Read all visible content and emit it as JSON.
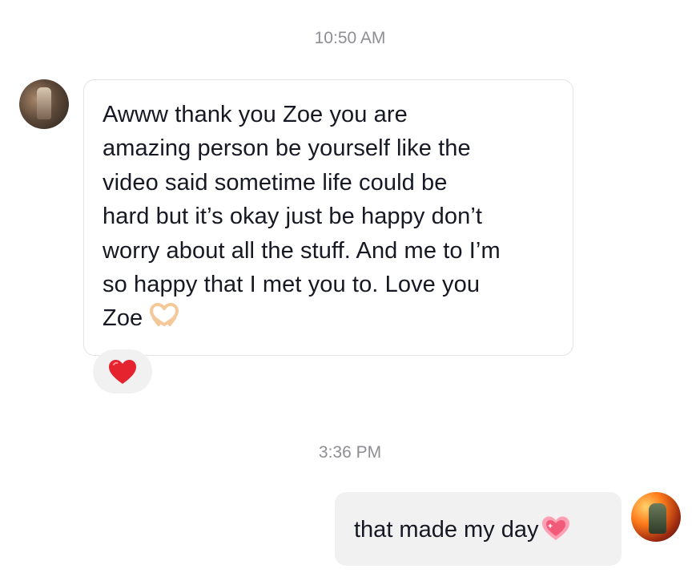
{
  "conversation": {
    "timestamps": [
      "10:50 AM",
      "3:36 PM"
    ],
    "incoming": {
      "lines": [
        "Awww thank you Zoe you are",
        "amazing person be yourself like the",
        "video said sometime life could be",
        "hard but it’s okay just be happy don’t",
        "worry about all the stuff. And me to I’m",
        "so happy that I met you to. Love you",
        "Zoe"
      ],
      "emoji": "heart-hands-icon",
      "reaction": "red-heart-icon"
    },
    "outgoing": {
      "text": "that made my day",
      "emoji": "sparkling-heart-icon"
    }
  },
  "colors": {
    "timestamp": "#8e8e93",
    "text": "#161823",
    "bubble_border": "#e3e3e6",
    "bubble_fill": "#f1f1f2",
    "reaction_heart": "#e4232f",
    "sparkle_heart": "#f25a7a"
  }
}
